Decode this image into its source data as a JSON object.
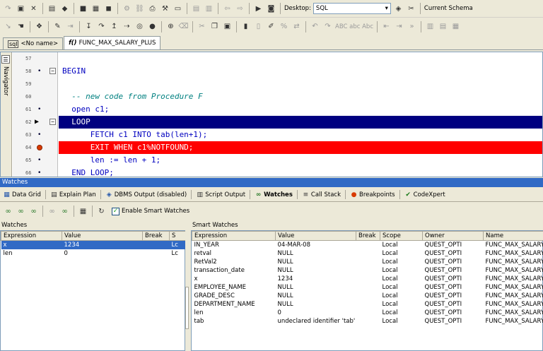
{
  "toolbar1": {
    "desktop_label": "Desktop:",
    "desktop_value": "SQL",
    "current_schema_label": "Current Schema"
  },
  "toolbar2": {
    "abc_label": "ABC abc Abc"
  },
  "doc_tabs": [
    {
      "label": "<No name>",
      "icon": "sql-icon"
    },
    {
      "label": "FUNC_MAX_SALARY_PLUS",
      "icon": "function-icon"
    }
  ],
  "navigator_label": "Navigator",
  "editor": {
    "lines": [
      {
        "num": "57",
        "text": "",
        "marker": "none"
      },
      {
        "num": "58",
        "text": "BEGIN",
        "marker": "dot",
        "fold": "⊟"
      },
      {
        "num": "59",
        "text": "",
        "marker": "none"
      },
      {
        "num": "60",
        "text": "  -- new code from Procedure F",
        "marker": "none",
        "style": "comment"
      },
      {
        "num": "61",
        "text": "  open c1;",
        "marker": "dot"
      },
      {
        "num": "62",
        "text": "  LOOP",
        "marker": "arrow",
        "fold": "⊟",
        "style": "current"
      },
      {
        "num": "63",
        "text": "      FETCH c1 INTO tab(len+1);",
        "marker": "dot"
      },
      {
        "num": "64",
        "text": "      EXIT WHEN c1%NOTFOUND;",
        "marker": "breakpoint",
        "style": "breakpoint"
      },
      {
        "num": "65",
        "text": "      len := len + 1;",
        "marker": "dot"
      },
      {
        "num": "66",
        "text": "  END LOOP;",
        "marker": "dot"
      }
    ]
  },
  "watches_title": "Watches",
  "bottom_tabs": [
    {
      "label": "Data Grid",
      "icon": "grid-icon"
    },
    {
      "label": "Explain Plan",
      "icon": "explain-icon"
    },
    {
      "label": "DBMS Output (disabled)",
      "icon": "dbms-icon"
    },
    {
      "label": "Script Output",
      "icon": "script-icon"
    },
    {
      "label": "Watches",
      "icon": "watches-icon",
      "active": true
    },
    {
      "label": "Call Stack",
      "icon": "callstack-icon"
    },
    {
      "label": "Breakpoints",
      "icon": "breakpoints-icon"
    },
    {
      "label": "CodeXpert",
      "icon": "codexpert-icon"
    }
  ],
  "watch_toolbar": {
    "enable_smart_label": "Enable Smart Watches",
    "enable_smart_checked": true
  },
  "watches": {
    "title": "Watches",
    "columns": [
      "Expression",
      "Value",
      "Break",
      "S"
    ],
    "rows": [
      {
        "expression": "x",
        "value": "1234",
        "brk": "",
        "s": "Lc",
        "selected": true
      },
      {
        "expression": "len",
        "value": "0",
        "brk": "",
        "s": "Lc"
      }
    ]
  },
  "smart_watches": {
    "title": "Smart Watches",
    "columns": [
      "Expression",
      "Value",
      "Break",
      "Scope",
      "Owner",
      "Name"
    ],
    "rows": [
      {
        "expression": "IN_YEAR",
        "value": "04-MAR-08",
        "brk": "",
        "scope": "Local",
        "owner": "QUEST_OPTI",
        "name": "FUNC_MAX_SALARY"
      },
      {
        "expression": "retval",
        "value": "NULL",
        "brk": "",
        "scope": "Local",
        "owner": "QUEST_OPTI",
        "name": "FUNC_MAX_SALARY"
      },
      {
        "expression": "RetVal2",
        "value": "NULL",
        "brk": "",
        "scope": "Local",
        "owner": "QUEST_OPTI",
        "name": "FUNC_MAX_SALARY"
      },
      {
        "expression": "transaction_date",
        "value": "NULL",
        "brk": "",
        "scope": "Local",
        "owner": "QUEST_OPTI",
        "name": "FUNC_MAX_SALARY"
      },
      {
        "expression": "x",
        "value": "1234",
        "brk": "",
        "scope": "Local",
        "owner": "QUEST_OPTI",
        "name": "FUNC_MAX_SALARY"
      },
      {
        "expression": "EMPLOYEE_NAME",
        "value": "NULL",
        "brk": "",
        "scope": "Local",
        "owner": "QUEST_OPTI",
        "name": "FUNC_MAX_SALARY"
      },
      {
        "expression": "GRADE_DESC",
        "value": "NULL",
        "brk": "",
        "scope": "Local",
        "owner": "QUEST_OPTI",
        "name": "FUNC_MAX_SALARY"
      },
      {
        "expression": "DEPARTMENT_NAME",
        "value": "NULL",
        "brk": "",
        "scope": "Local",
        "owner": "QUEST_OPTI",
        "name": "FUNC_MAX_SALARY"
      },
      {
        "expression": "len",
        "value": "0",
        "brk": "",
        "scope": "Local",
        "owner": "QUEST_OPTI",
        "name": "FUNC_MAX_SALARY"
      },
      {
        "expression": "tab",
        "value": "undeclared identifier 'tab'",
        "brk": "",
        "scope": "Local",
        "owner": "QUEST_OPTI",
        "name": "FUNC_MAX_SALARY"
      }
    ]
  }
}
